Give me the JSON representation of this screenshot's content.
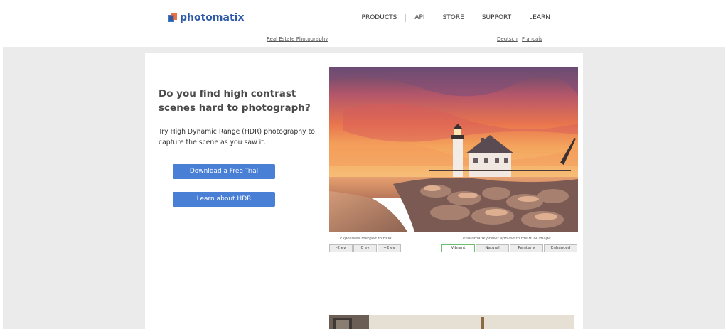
{
  "header": {
    "brand": "photomatix",
    "nav": [
      "PRODUCTS",
      "API",
      "STORE",
      "SUPPORT",
      "LEARN"
    ],
    "sub_link": "Real Estate Photography",
    "languages": [
      "Deutsch",
      "Francais"
    ]
  },
  "hero": {
    "headline": "Do you find high contrast scenes hard to photograph?",
    "lede": "Try High Dynamic Range (HDR) photography to capture the scene as you saw it.",
    "primary_button": "Download a Free Trial",
    "secondary_button": "Learn about HDR"
  },
  "demo": {
    "exposures_caption": "Exposures merged to HDR",
    "presets_caption": "Photomatix preset applied to the HDR image",
    "exposures": [
      "-2 ev",
      "0 ev",
      "+2 ev"
    ],
    "presets": [
      "Vibrant",
      "Natural",
      "Painterly",
      "Enhanced"
    ],
    "active_preset": "Vibrant"
  },
  "colors": {
    "brand": "#2f5aa8",
    "button": "#4a7fd6",
    "page_bg": "#ebebeb",
    "active_outline": "#6dbf6d"
  }
}
